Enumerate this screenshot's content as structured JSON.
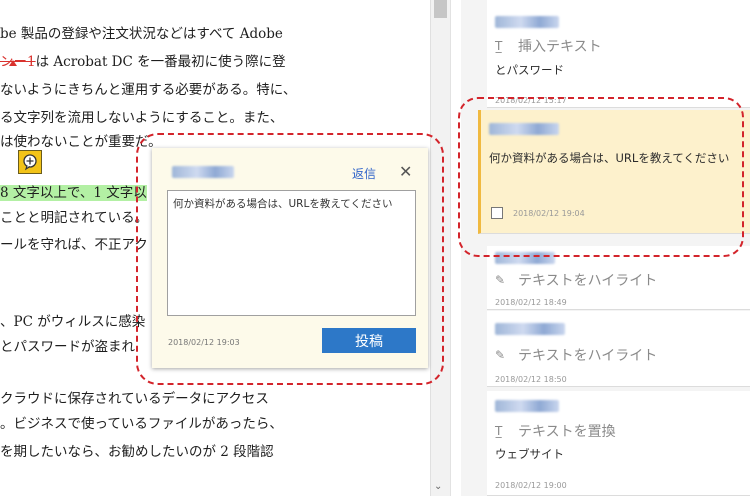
{
  "document": {
    "lines": [
      {
        "pre": "be 製品の登録や注文状況などはすべて Adobe",
        "hl": "",
        "strike": "",
        "post": ""
      },
      {
        "pre": "",
        "hl": "",
        "strike": "ンー1",
        "post": "は Acrobat DC を一番最初に使う際に登"
      },
      {
        "pre": "ないようにきちんと運用する必要がある。特に、",
        "hl": "",
        "strike": "",
        "post": ""
      },
      {
        "pre": "る文字列を流用しないようにすること。また、",
        "hl": "",
        "strike": "",
        "post": ""
      },
      {
        "pre": "は使わないことが重要だ。",
        "hl": "",
        "strike": "",
        "post": ""
      },
      {
        "pre": "",
        "hl": "8 文字以上で、1 文字以",
        "strike": "",
        "post": ""
      },
      {
        "pre": "ことと明記されている。",
        "hl": "",
        "strike": "",
        "post": ""
      },
      {
        "pre": "ールを守れば、不正アク",
        "hl": "",
        "strike": "",
        "post": ""
      },
      {
        "pre": "、PC がウィルスに感染",
        "hl": "",
        "strike": "",
        "post": ""
      },
      {
        "pre": "とパスワードが盗まれ",
        "hl": "",
        "strike": "",
        "post": ""
      },
      {
        "pre": "クラウドに保存されているデータにアクセス",
        "hl": "",
        "strike": "",
        "post": ""
      },
      {
        "pre": "。ビジネスで使っているファイルがあったら、",
        "hl": "",
        "strike": "",
        "post": ""
      },
      {
        "pre": "を期したいなら、お勧めしたいのが 2 段階認",
        "hl": "",
        "strike": "",
        "post": ""
      }
    ]
  },
  "popup": {
    "reply_label": "返信",
    "close_glyph": "✕",
    "text": "何か資料がある場合は、URLを教えてください",
    "date": "2018/02/12 19:03",
    "post_label": "投稿"
  },
  "comments": [
    {
      "type": "挿入テキスト",
      "icon": "insert-text-icon",
      "glyph": "T̲",
      "text": "とパスワード",
      "date": "2018/02/12 15:17",
      "selected": false
    },
    {
      "type": "",
      "icon": "",
      "glyph": "",
      "text": "何か資料がある場合は、URLを教えてください",
      "date": "2018/02/12 19:04",
      "selected": true
    },
    {
      "type": "テキストをハイライト",
      "icon": "highlight-pen-icon",
      "glyph": "✎",
      "text": "",
      "date": "2018/02/12 18:49",
      "selected": false
    },
    {
      "type": "テキストをハイライト",
      "icon": "highlight-pen-icon",
      "glyph": "✎",
      "text": "",
      "date": "2018/02/12 18:50",
      "selected": false
    },
    {
      "type": "テキストを置換",
      "icon": "replace-text-icon",
      "glyph": "T̲",
      "text": "ウェブサイト",
      "date": "2018/02/12 19:00",
      "selected": false
    }
  ],
  "colors": {
    "annotation_dash": "#d3242b",
    "highlight": "#b3f0a4",
    "selected_card": "#fdf1cc",
    "post_button": "#2d78c8"
  }
}
